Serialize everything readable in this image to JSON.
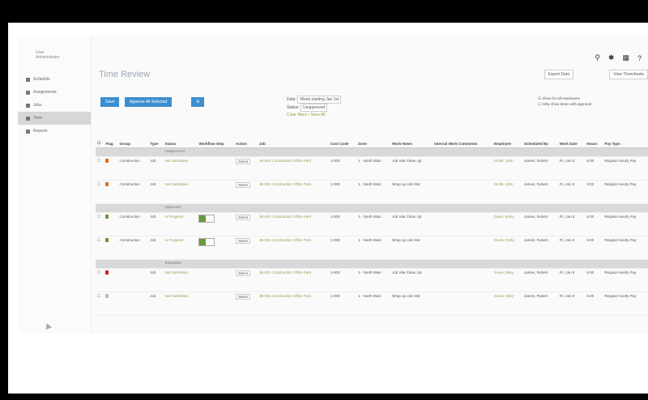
{
  "sidebar": {
    "user_name": "User",
    "user_sub": "Administrator",
    "items": [
      {
        "label": "Schedule",
        "icon": "calendar-icon"
      },
      {
        "label": "Assignments",
        "icon": "list-icon"
      },
      {
        "label": "Jobs",
        "icon": "wrench-icon"
      },
      {
        "label": "Time",
        "icon": "clock-icon",
        "active": true
      },
      {
        "label": "Reports",
        "icon": "chart-icon"
      }
    ]
  },
  "header": {
    "title": "Time Review",
    "export_label": "Export Data",
    "view_label": "View Timesheets"
  },
  "toolbar": {
    "approve_label": "Save",
    "approve_all_label": "Approve All Selected",
    "settings_label": "⚙"
  },
  "filters": {
    "date_label": "Date:",
    "date_value": "Week starting Jan 1st",
    "status_label": "Status:",
    "status_value": "Unapproved",
    "clear_label": "Clear filters / Save All"
  },
  "checks": {
    "opt1": "Show for all employees",
    "opt2": "Only show times with approval"
  },
  "columns": [
    "Flag",
    "Group",
    "Type",
    "Status",
    "Workflow Step",
    "Action",
    "Job",
    "Cost Code",
    "Zone",
    "Work Notes",
    "Internal Work Comments",
    "Employee",
    "Scheduled By",
    "Work Date",
    "Hours",
    "Pay Type"
  ],
  "groups": [
    {
      "label": "Unapproved",
      "rows": [
        {
          "flag": "#e07020",
          "group": "Construction",
          "type": "Job",
          "status": "Not Submitted",
          "action": "Select",
          "job": "JB-001 Construction Office Park",
          "cost": "1-000",
          "zone": "1 - North Main",
          "notes": "Job Site Clean Up",
          "employee": "Smith, John",
          "sched": "James, Robert",
          "date": "Fri, Jan 5",
          "hours": "8.00",
          "paytype": "Regular Hourly Pay"
        },
        {
          "flag": "#e07020",
          "group": "Construction",
          "type": "Job",
          "status": "Not Submitted",
          "action": "Select",
          "job": "JB-001 Construction Office Park",
          "cost": "1-000",
          "zone": "1 - North Main",
          "notes": "Wrap up Job Site",
          "employee": "Smith, John",
          "sched": "James, Robert",
          "date": "Fri, Jan 5",
          "hours": "8.00",
          "paytype": "Regular Hourly Pay"
        }
      ]
    },
    {
      "label": "Approved",
      "rows": [
        {
          "flag": "#6a9a3a",
          "group": "Construction",
          "type": "Job",
          "status": "In Progress",
          "action": "Select",
          "job": "JB-001 Construction Office Park",
          "cost": "1-000",
          "zone": "1 - North Main",
          "notes": "Job Site Clean Up",
          "employee": "Davis, Emily",
          "sched": "James, Robert",
          "date": "Fri, Jan 5",
          "hours": "8.00",
          "paytype": "Regular Hourly Pay"
        },
        {
          "flag": "#6a9a3a",
          "group": "Construction",
          "type": "Job",
          "status": "In Progress",
          "action": "Select",
          "job": "JB-001 Construction Office Park",
          "cost": "1-000",
          "zone": "1 - North Main",
          "notes": "Wrap up Job Site",
          "employee": "Davis, Emily",
          "sched": "James, Robert",
          "date": "Fri, Jan 5",
          "hours": "8.00",
          "paytype": "Regular Hourly Pay"
        }
      ]
    },
    {
      "label": "Submitted",
      "rows": [
        {
          "flag": "#d02020",
          "group": "",
          "type": "Job",
          "status": "Not Submitted",
          "action": "Select",
          "job": "JB-001 Construction Office Park",
          "cost": "1-000",
          "zone": "1 - North Main",
          "notes": "Job Site Clean Up",
          "employee": "Jones, Mary",
          "sched": "James, Robert",
          "date": "Fri, Jan 5",
          "hours": "8.00",
          "paytype": "Regular Hourly Pay"
        },
        {
          "flag": "#bbbbbb",
          "group": "",
          "type": "Job",
          "status": "Not Submitted",
          "action": "Select",
          "job": "JB-001 Construction Office Park",
          "cost": "1-000",
          "zone": "1 - North Main",
          "notes": "Wrap up Job Site",
          "employee": "Jones, Mary",
          "sched": "James, Robert",
          "date": "Fri, Jan 5",
          "hours": "8.00",
          "paytype": "Regular Hourly Pay"
        }
      ]
    }
  ]
}
